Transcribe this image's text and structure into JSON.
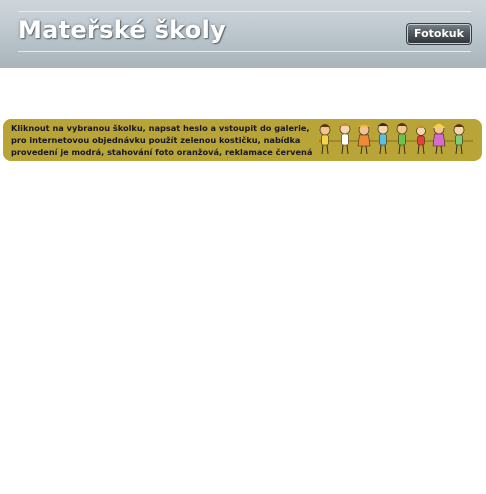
{
  "header": {
    "title": "Mateřské školy",
    "button_label": "Fotokuk"
  },
  "banner": {
    "lines": [
      "Kliknout na vybranou školku, napsat heslo a vstoupit do galerie,",
      "pro internetovou objednávku použít zelenou kostičku, nabídka",
      "provedení je modrá, stahování foto oranžová, reklamace červená"
    ],
    "illustration": "children-holding-hands",
    "background_color": "#b9a537"
  },
  "colors": {
    "header_gradient_top": "#cfd6db",
    "header_gradient_bottom": "#a9b3ba",
    "button_dark": "#2d3338"
  }
}
